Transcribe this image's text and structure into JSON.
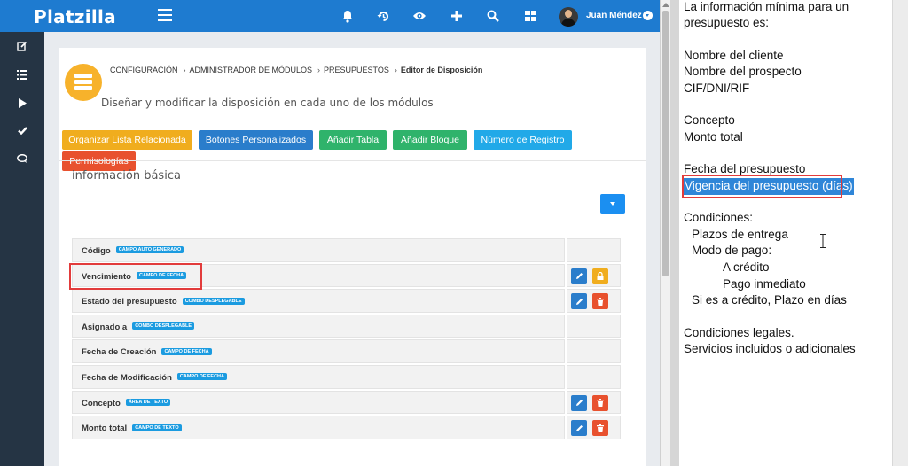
{
  "app": {
    "logo": "Platzilla",
    "user_name": "Juan Méndez",
    "topbar_icons": [
      "bell-icon",
      "history-icon",
      "eye-icon",
      "plus-icon",
      "search-icon",
      "grid-icon"
    ],
    "sidebar_icons": [
      "edit-icon",
      "list-icon",
      "play-icon",
      "check-icon",
      "chat-icon"
    ]
  },
  "breadcrumb": {
    "items": [
      "CONFIGURACIÓN",
      "ADMINISTRADOR DE MÓDULOS",
      "PRESUPUESTOS"
    ],
    "separator": "›",
    "current": "Editor de Disposición"
  },
  "subtitle": "Diseñar y modificar la disposición en cada uno de los módulos",
  "toolbar": {
    "related_list": "Organizar Lista Relacionada",
    "custom_buttons": "Botones Personalizados",
    "add_table": "Añadir Tabla",
    "add_block": "Añadir Bloque",
    "record_number": "Número de Registro",
    "permissions": "Permisologías"
  },
  "section": {
    "title": "información básica"
  },
  "fields": [
    {
      "label": "Código",
      "tag": "CAMPO AUTO GENERADO",
      "actions": "none"
    },
    {
      "label": "Vencimiento",
      "tag": "CAMPO DE FECHA",
      "actions": "edit-lock"
    },
    {
      "label": "Estado del presupuesto",
      "tag": "COMBO DESPLEGABLE",
      "actions": "edit-delete"
    },
    {
      "label": "Asignado a",
      "tag": "COMBO DESPLEGABLE",
      "actions": "none"
    },
    {
      "label": "Fecha de Creación",
      "tag": "CAMPO DE FECHA",
      "actions": "none"
    },
    {
      "label": "Fecha de Modificación",
      "tag": "CAMPO DE FECHA",
      "actions": "none"
    },
    {
      "label": "Concepto",
      "tag": "ÁREA DE TEXTO",
      "actions": "edit-delete"
    },
    {
      "label": "Monto total",
      "tag": "CAMPO DE TEXTO",
      "actions": "edit-delete"
    }
  ],
  "document": {
    "intro_1": "La información mínima para un",
    "intro_2": "presupuesto es:",
    "client": "Nombre del cliente",
    "prospect": "Nombre del prospecto",
    "tax_id": "CIF/DNI/RIF",
    "concept": "Concepto",
    "total": "Monto total",
    "date": "Fecha del presupuesto",
    "validity": "Vigencia del presupuesto (días)",
    "conditions": "Condiciones:",
    "delivery": "Plazos de entrega",
    "payment_mode": "Modo de pago:",
    "credit": "A crédito",
    "immediate": "Pago inmediato",
    "credit_term": "Si es a crédito, Plazo en días",
    "legal": "Condiciones legales.",
    "services": "Servicios incluidos o adicionales"
  },
  "colors": {
    "topbar": "#1e7bd0",
    "sidebar": "#253444",
    "highlight": "#e23b3b",
    "tag": "#1b9be0"
  }
}
